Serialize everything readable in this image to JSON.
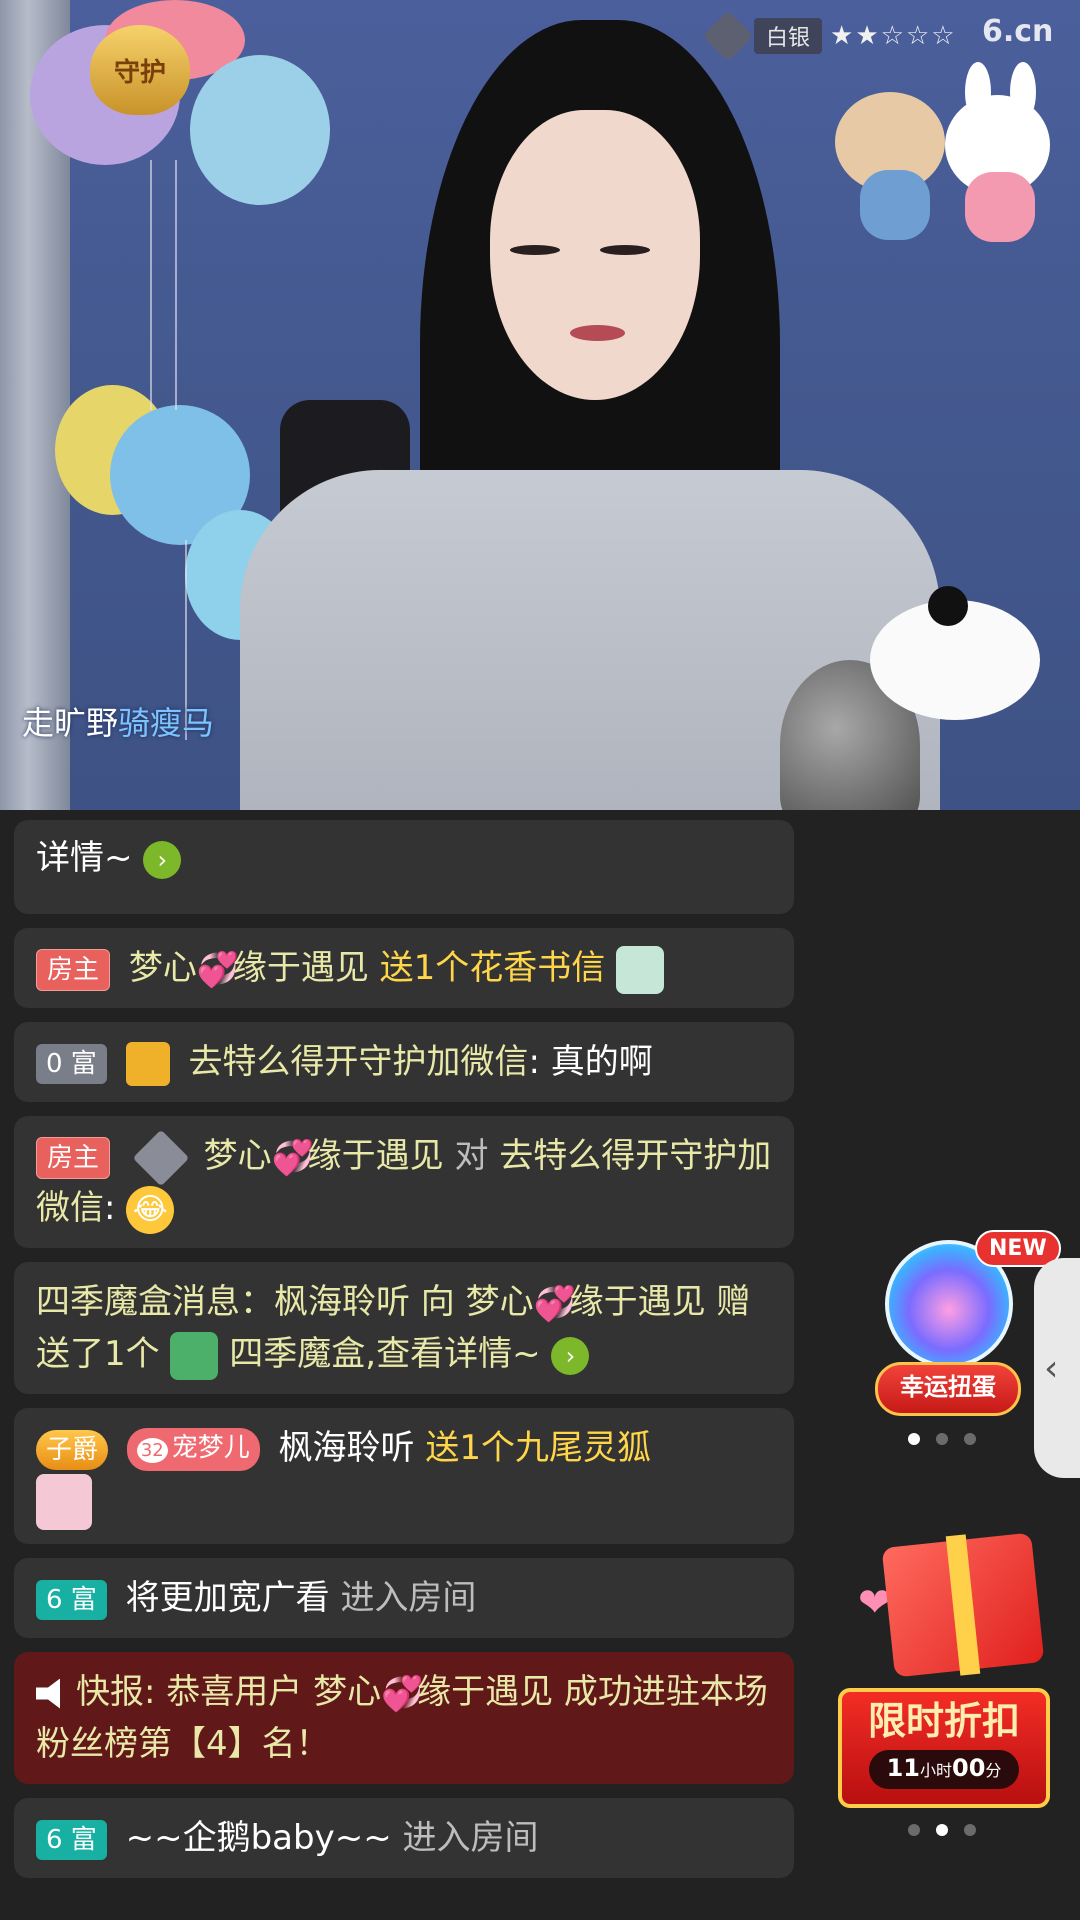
{
  "video": {
    "guard_badge": "守护",
    "rank_label": "白银",
    "rank_stars": "★★☆☆☆",
    "logo_main": "6",
    "logo_suffix": ".cn",
    "streamer_name_a": "走旷野",
    "streamer_name_b": "骑瘦马"
  },
  "chat": {
    "msg0": {
      "text": "详情~",
      "go": "›"
    },
    "msg1": {
      "tag": "房主",
      "user": "梦心",
      "user_suffix": "缘于遇见",
      "action": "送1个花香书信"
    },
    "msg2": {
      "tag": "0 富",
      "user": "去特么得开守护加微信",
      "sep": ":",
      "text": "真的啊"
    },
    "msg3": {
      "tag": "房主",
      "user": "梦心",
      "user_suffix": "缘于遇见",
      "mid": "对",
      "target": "去特么得开守护加微信",
      "sep": ":",
      "emoji": "😂"
    },
    "msg4": {
      "text_a": "四季魔盒消息：枫海聆听 向 梦心",
      "text_b": "缘于遇见 赠送了1个",
      "text_c": "四季魔盒,查看详情~",
      "go": "›"
    },
    "msg5": {
      "tag_noble": "子爵",
      "tag_pet_level": "32",
      "tag_pet": "宠梦儿",
      "user": "枫海聆听",
      "action": "送1个九尾灵狐"
    },
    "msg6": {
      "tag": "6 富",
      "user": "将更加宽广看",
      "action": "进入房间"
    },
    "msg7": {
      "prefix": "快报:",
      "text_a": "恭喜用户 梦心",
      "text_b": "缘于遇见 成功进驻本场粉丝榜第【4】名！"
    },
    "msg8": {
      "tag": "6 富",
      "user": "~~企鹅baby~~",
      "action": "进入房间"
    }
  },
  "egg": {
    "badge": "NEW",
    "label": "幸运扭蛋"
  },
  "side_toggle": "‹",
  "promo": {
    "title": "限时折扣",
    "hours": "11",
    "hours_unit": "小时",
    "minutes": "00",
    "minutes_unit": "分"
  },
  "colors": {
    "host_tag": "#e8615c",
    "rich_tag": "#18b0a2",
    "gold_text": "#ffd54a",
    "alert_bg": "#611818"
  }
}
